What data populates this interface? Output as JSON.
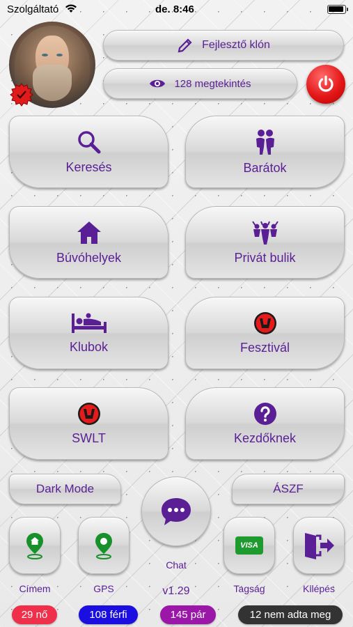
{
  "status_bar": {
    "carrier": "Szolgáltató",
    "time": "de. 8:46"
  },
  "header": {
    "dev_clone_label": "Fejlesztő klón",
    "views_label": "128 megtekintés"
  },
  "tiles": [
    {
      "label": "Keresés",
      "icon": "search-icon"
    },
    {
      "label": "Barátok",
      "icon": "couple-icon"
    },
    {
      "label": "Búvóhelyek",
      "icon": "home-icon"
    },
    {
      "label": "Privát bulik",
      "icon": "party-icon"
    },
    {
      "label": "Klubok",
      "icon": "bed-icon"
    },
    {
      "label": "Fesztivál",
      "icon": "festival-logo-icon"
    },
    {
      "label": "SWLT",
      "icon": "swlt-logo-icon"
    },
    {
      "label": "Kezdőknek",
      "icon": "question-icon"
    }
  ],
  "small_buttons": {
    "dark_mode": "Dark Mode",
    "terms": "ÁSZF"
  },
  "bottom": {
    "address": "Címem",
    "gps": "GPS",
    "chat": "Chat",
    "version": "v1.29",
    "membership": "Tagság",
    "logout": "Kilépés",
    "visa_text": "VISA"
  },
  "counts": {
    "women": "29 nő",
    "men": "108 férfi",
    "couples": "145 pár",
    "unspecified": "12 nem adta meg"
  },
  "colors": {
    "accent": "#5a1e95",
    "power": "#e41818",
    "women_badge": "#f0304a",
    "men_badge": "#1a0fe0",
    "couples_badge": "#9a17a8",
    "unspecified_badge": "#333333",
    "gps_green": "#19912b"
  }
}
